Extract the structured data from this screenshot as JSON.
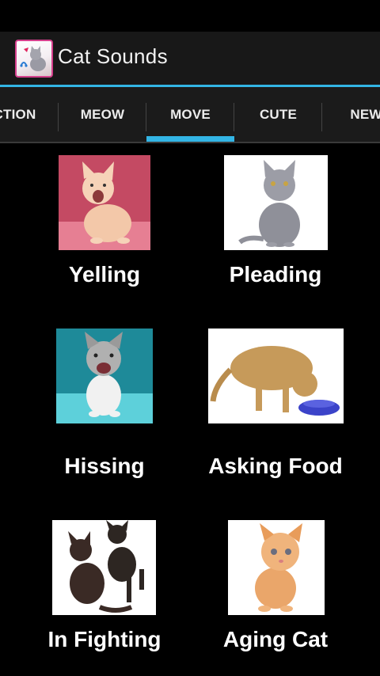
{
  "app": {
    "title": "Cat Sounds",
    "icon": "cat-app-icon",
    "accent_color": "#33b5e5",
    "icon_border_color": "#d53f8c"
  },
  "tabs": [
    {
      "label": "CTION"
    },
    {
      "label": "MEOW"
    },
    {
      "label": "MOVE",
      "active": true
    },
    {
      "label": "CUTE"
    },
    {
      "label": "NEW"
    }
  ],
  "sounds": [
    {
      "label": "Yelling",
      "image": "ginger-kitten-yelling-photo",
      "bg": "#c44a63"
    },
    {
      "label": "Pleading",
      "image": "grey-cat-sitting-photo",
      "bg": "#ffffff"
    },
    {
      "label": "Hissing",
      "image": "tabby-kitten-teal-background-photo",
      "bg": "#2fa6b3"
    },
    {
      "label": "Asking Food",
      "image": "cat-eating-from-bowl-photo",
      "bg": "#ffffff"
    },
    {
      "label": "In Fighting",
      "image": "two-dark-kittens-photo",
      "bg": "#ffffff"
    },
    {
      "label": "Aging Cat",
      "image": "orange-kitten-photo",
      "bg": "#ffffff"
    }
  ]
}
